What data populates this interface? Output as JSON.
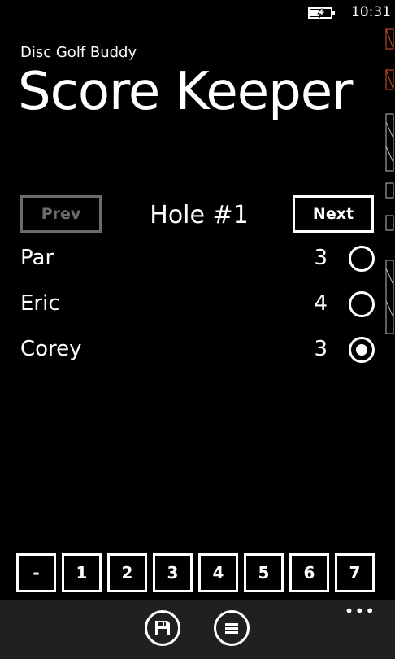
{
  "status_bar": {
    "time": "10:31",
    "battery_icon": "battery-charging-icon"
  },
  "app": {
    "name": "Disc Golf Buddy",
    "page_title": "Score Keeper"
  },
  "nav": {
    "prev_label": "Prev",
    "prev_enabled": false,
    "next_label": "Next",
    "hole_title": "Hole #1"
  },
  "rows": [
    {
      "name": "Par",
      "score": "3",
      "selected": false
    },
    {
      "name": "Eric",
      "score": "4",
      "selected": false
    },
    {
      "name": "Corey",
      "score": "3",
      "selected": true
    }
  ],
  "number_pad": [
    "-",
    "1",
    "2",
    "3",
    "4",
    "5",
    "6",
    "7"
  ],
  "app_bar": {
    "more_label": "•••",
    "buttons": [
      {
        "icon": "save-icon"
      },
      {
        "icon": "list-menu-icon"
      }
    ],
    "background": "#202020"
  },
  "colors": {
    "background": "#000000",
    "foreground": "#ffffff",
    "disabled": "#6b6b6b"
  }
}
